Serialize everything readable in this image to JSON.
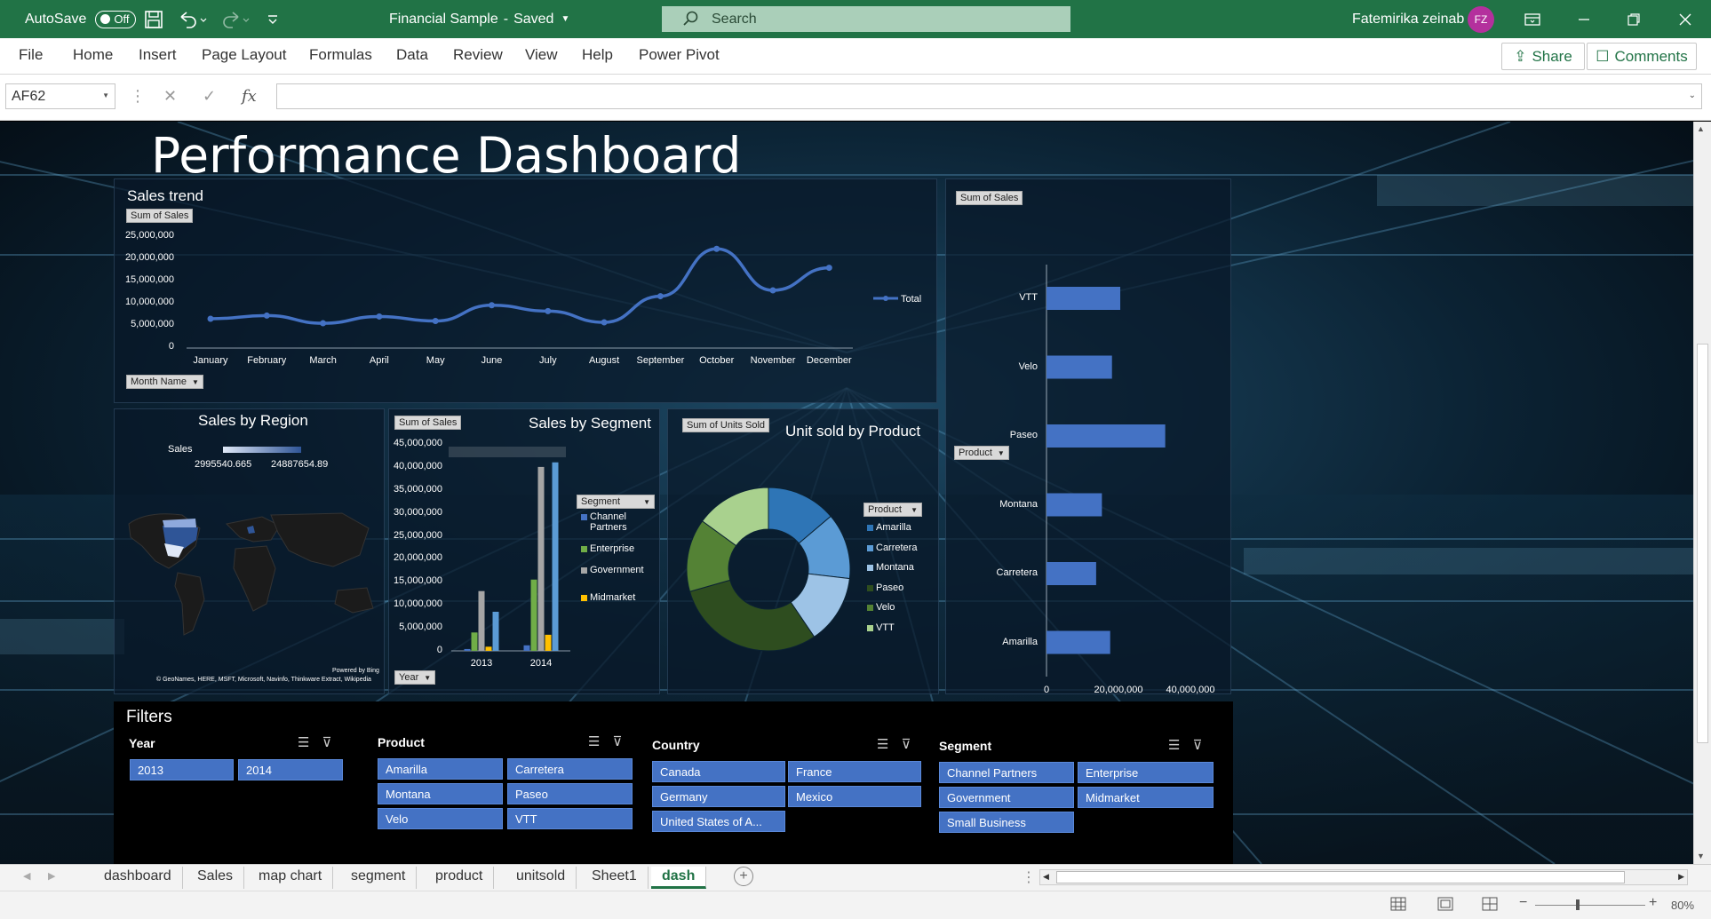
{
  "titlebar": {
    "autosave_label": "AutoSave",
    "autosave_state": "Off",
    "doc_title": "Financial Sample",
    "doc_status": "Saved",
    "search_placeholder": "Search",
    "user_name": "Fatemirika zeinab",
    "user_initials": "FZ",
    "accent": "#217346"
  },
  "ribbon": {
    "tabs": [
      "File",
      "Home",
      "Insert",
      "Page Layout",
      "Formulas",
      "Data",
      "Review",
      "View",
      "Help",
      "Power Pivot"
    ],
    "share_label": "Share",
    "comments_label": "Comments"
  },
  "formula_bar": {
    "name_box": "AF62",
    "formula": ""
  },
  "dashboard": {
    "title": "Performance Dashboard",
    "sales_trend": {
      "title": "Sales trend",
      "field_value": "Sum of Sales",
      "field_axis": "Month Name",
      "legend": "Total",
      "y_ticks": [
        "25,000,000",
        "20,000,000",
        "15,000,000",
        "10,000,000",
        "5,000,000",
        "0"
      ]
    },
    "sales_by_region": {
      "title": "Sales by Region",
      "legend_label": "Sales",
      "legend_min": "2995540.665",
      "legend_max": "24887654.89",
      "attribution_1": "Powered by Bing",
      "attribution_2": "© GeoNames, HERE, MSFT, Microsoft, Navinfo, Thinkware Extract, Wikipedia"
    },
    "sales_by_segment": {
      "title": "Sales by Segment",
      "field_value": "Sum of Sales",
      "field_legend": "Segment",
      "field_axis": "Year",
      "y_ticks": [
        "45,000,000",
        "40,000,000",
        "35,000,000",
        "30,000,000",
        "25,000,000",
        "20,000,000",
        "15,000,000",
        "10,000,000",
        "5,000,000",
        "0"
      ]
    },
    "unit_sold_by_product": {
      "title": "Unit sold by Product",
      "field_value": "Sum of Units Sold",
      "field_legend": "Product"
    },
    "product_sales": {
      "field_value": "Sum of Sales",
      "field_axis": "Product",
      "x_ticks": [
        "0",
        "20,000,000",
        "40,000,000"
      ]
    }
  },
  "chart_data": [
    {
      "type": "line",
      "title": "Sales trend",
      "categories": [
        "January",
        "February",
        "March",
        "April",
        "May",
        "June",
        "July",
        "August",
        "September",
        "October",
        "November",
        "December"
      ],
      "series": [
        {
          "name": "Total",
          "values": [
            6500000,
            7200000,
            5500000,
            7000000,
            6000000,
            9500000,
            8200000,
            5700000,
            11500000,
            22000000,
            12800000,
            17800000
          ]
        }
      ],
      "ylim": [
        0,
        25000000
      ],
      "color": "#4472c4"
    },
    {
      "type": "bar",
      "title": "Sales by Segment",
      "categories": [
        "2013",
        "2014"
      ],
      "series": [
        {
          "name": "Channel Partners",
          "values": [
            400000,
            1200000
          ],
          "color": "#4472c4"
        },
        {
          "name": "Enterprise",
          "values": [
            4000000,
            15500000
          ],
          "color": "#70ad47"
        },
        {
          "name": "Government",
          "values": [
            13000000,
            40000000
          ],
          "color": "#a5a5a5"
        },
        {
          "name": "Midmarket",
          "values": [
            900000,
            3500000
          ],
          "color": "#ffc000"
        },
        {
          "name": "Small Business",
          "values": [
            8500000,
            41000000
          ],
          "color": "#5b9bd5"
        }
      ],
      "ylim": [
        0,
        45000000
      ]
    },
    {
      "type": "pie",
      "title": "Unit sold by Product",
      "donut": true,
      "labels": [
        "Amarilla",
        "Carretera",
        "Montana",
        "Paseo",
        "Velo",
        "VTT"
      ],
      "values": [
        155315,
        146846,
        154198,
        338239,
        162424,
        168783
      ],
      "colors": [
        "#2e75b6",
        "#5b9bd5",
        "#9dc3e6",
        "#2e4d1f",
        "#548235",
        "#a9d18e"
      ]
    },
    {
      "type": "bar",
      "orientation": "horizontal",
      "title": "Sum of Sales",
      "categories": [
        "VTT",
        "Velo",
        "Paseo",
        "Montana",
        "Carretera",
        "Amarilla"
      ],
      "values": [
        20500000,
        18200000,
        33000000,
        15400000,
        13800000,
        17700000
      ],
      "xlim": [
        0,
        40000000
      ],
      "color": "#4472c4"
    }
  ],
  "filters": {
    "title": "Filters",
    "year": {
      "title": "Year",
      "items": [
        "2013",
        "2014"
      ]
    },
    "product": {
      "title": "Product",
      "items": [
        "Amarilla",
        "Carretera",
        "Montana",
        "Paseo",
        "Velo",
        "VTT"
      ]
    },
    "country": {
      "title": "Country",
      "items": [
        "Canada",
        "France",
        "Germany",
        "Mexico",
        "United States of A..."
      ]
    },
    "segment": {
      "title": "Segment",
      "items": [
        "Channel Partners",
        "Enterprise",
        "Government",
        "Midmarket",
        "Small Business"
      ]
    }
  },
  "sheet_tabs": [
    "dashboard",
    "Sales",
    "map chart",
    "segment",
    "product",
    "unitsold",
    "Sheet1",
    "dash"
  ],
  "active_tab": "dash",
  "status": {
    "zoom": "80%"
  }
}
